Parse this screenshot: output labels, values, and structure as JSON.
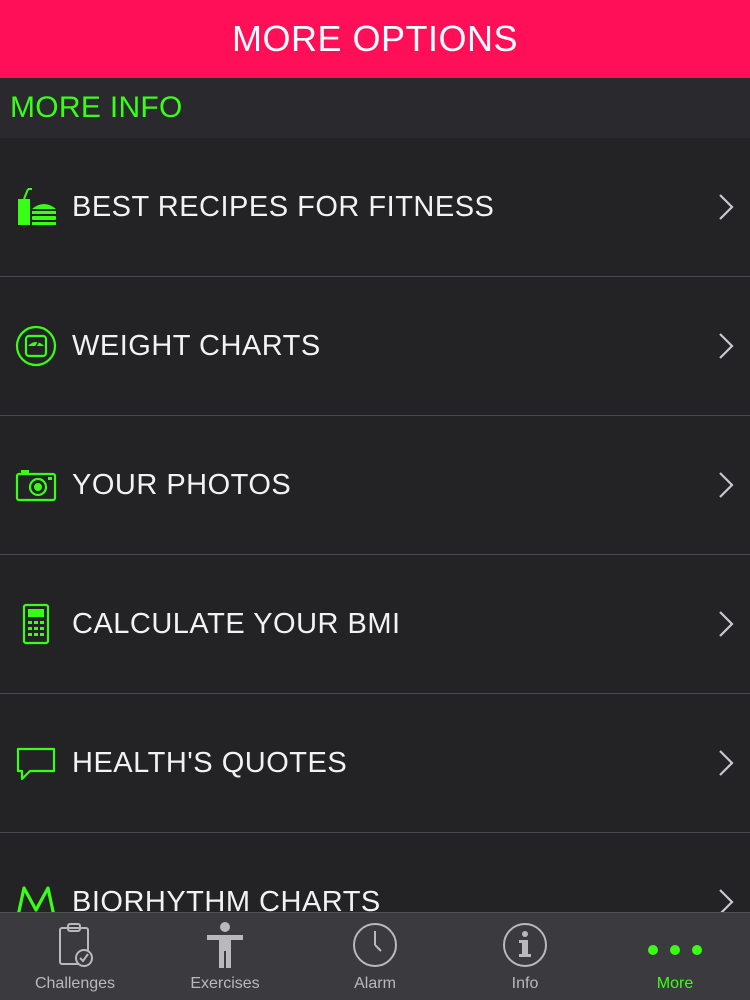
{
  "header": {
    "title": "MORE OPTIONS"
  },
  "section": {
    "title": "MORE INFO"
  },
  "menu": {
    "items": [
      {
        "label": "BEST RECIPES FOR FITNESS",
        "icon": "food-icon"
      },
      {
        "label": "WEIGHT CHARTS",
        "icon": "scale-icon"
      },
      {
        "label": "YOUR PHOTOS",
        "icon": "camera-icon"
      },
      {
        "label": "CALCULATE YOUR BMI",
        "icon": "calculator-icon"
      },
      {
        "label": "HEALTH'S QUOTES",
        "icon": "speech-bubble-icon"
      },
      {
        "label": "BIORHYTHM CHARTS",
        "icon": "biorhythm-icon"
      }
    ]
  },
  "tabbar": {
    "tabs": [
      {
        "label": "Challenges",
        "icon": "clipboard-check-icon"
      },
      {
        "label": "Exercises",
        "icon": "person-icon"
      },
      {
        "label": "Alarm",
        "icon": "clock-icon"
      },
      {
        "label": "Info",
        "icon": "info-icon"
      },
      {
        "label": "More",
        "icon": "more-dots-icon",
        "active": true
      }
    ]
  },
  "colors": {
    "header_bg": "#ff0f57",
    "accent_green": "#39ff14",
    "background": "#232326",
    "tabbar_bg": "#3b3b3f"
  }
}
